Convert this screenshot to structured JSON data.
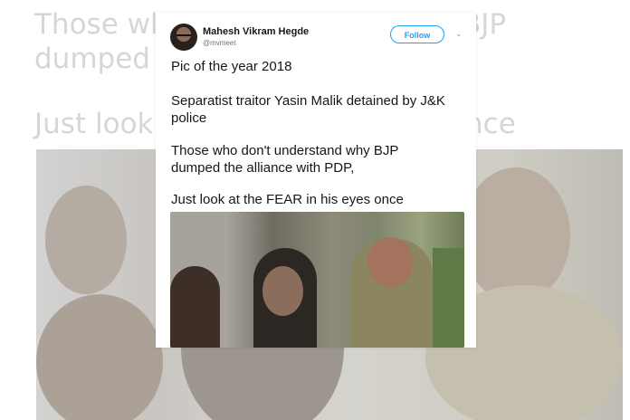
{
  "background": {
    "line1_left": "Those wh",
    "line1_right": "BJP",
    "line2_left": "dumped t",
    "line3_left": "Just look",
    "line3_right": "nce"
  },
  "tweet": {
    "author_name": "Mahesh Vikram Hegde",
    "author_handle": "@mvmeet",
    "follow_label": "Follow",
    "caret": "⌄",
    "lines": [
      "Pic of the year 2018",
      "Separatist traitor Yasin Malik detained by J&K",
      "police",
      "Those who don't understand why BJP",
      "dumped the alliance with PDP,",
      "Just look at the FEAR in his eyes once"
    ]
  },
  "colors": {
    "accent": "#1da1f2",
    "text": "#14171a",
    "muted": "#657786",
    "faded": "#d6d6d6"
  }
}
